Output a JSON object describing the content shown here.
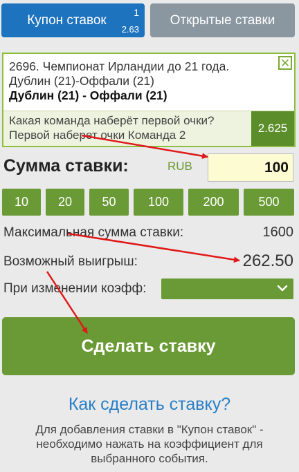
{
  "tabs": {
    "coupon": {
      "label": "Купон ставок",
      "count": "1",
      "odds": "2.63"
    },
    "open": {
      "label": "Открытые ставки"
    }
  },
  "event": {
    "league": "2696. Чемпионат Ирландии до 21 года.",
    "teams_line": "Дублин (21)-Оффали (21)",
    "match": "Дублин (21) - Оффали (21)",
    "close_symbol": "✕",
    "market_question": "Какая команда наберёт первой очки?",
    "market_selection": "Первой наберет очки Команда 2",
    "odds": "2.625"
  },
  "stake": {
    "label": "Сумма ставки:",
    "currency": "RUB",
    "value": "100"
  },
  "quick_amounts": [
    "10",
    "20",
    "50",
    "100",
    "200",
    "500"
  ],
  "info": {
    "max_label": "Максимальная сумма ставки:",
    "max_value": "1600",
    "win_label": "Возможный выигрыш:",
    "win_value": "262.50",
    "odds_change_label": "При изменении коэфф:",
    "odds_change_value": ""
  },
  "place_bet_label": "Сделать ставку",
  "help": {
    "title": "Как сделать ставку?",
    "description": "Для добавления ставки в \"Купон ставок\" - необходимо нажать на коэффициент для выбранного события."
  },
  "colors": {
    "primary_green": "#6a9a35",
    "tab_blue": "#1e73be",
    "tab_gray": "#8a97a0",
    "link_blue": "#2a7fc7",
    "input_yellow": "#fdfbd2",
    "arrow_red": "#e01818"
  }
}
